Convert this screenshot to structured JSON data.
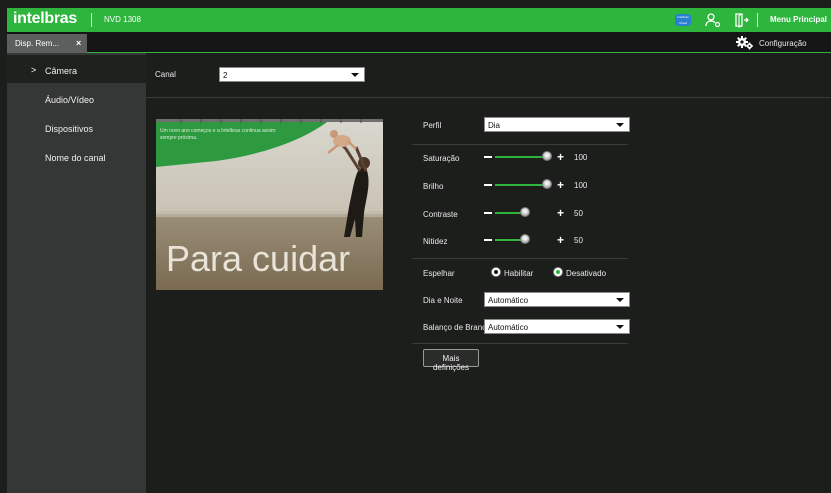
{
  "header": {
    "logo": "intelbras",
    "model": "NVD 1308",
    "cloud_label": "Intelbras Cloud",
    "menu_principal": "Menu Principal",
    "icons": [
      "cloud-icon",
      "user-settings-icon",
      "logout-icon"
    ]
  },
  "tabs": {
    "active_tab": "Disp. Rem...",
    "close": "×",
    "config_label": "Configuração"
  },
  "sidebar": {
    "items": [
      {
        "label": "Câmera",
        "active": true
      },
      {
        "label": "Áudio/Vídeo",
        "active": false
      },
      {
        "label": "Dispositivos",
        "active": false
      },
      {
        "label": "Nome do canal",
        "active": false
      }
    ]
  },
  "main": {
    "canal_label": "Canal",
    "canal_value": "2",
    "photo": {
      "caption": "Um novo ano começou e a Intelbras continua assim: sempre próxima.",
      "headline": "Para cuidar"
    },
    "perfil_label": "Perfil",
    "perfil_value": "Dia",
    "sliders": [
      {
        "label": "Saturação",
        "value": 100,
        "fraction": 1.0
      },
      {
        "label": "Brilho",
        "value": 100,
        "fraction": 1.0
      },
      {
        "label": "Contraste",
        "value": 50,
        "fraction": 0.5
      },
      {
        "label": "Nitidez",
        "value": 50,
        "fraction": 0.5
      }
    ],
    "espelhar_label": "Espelhar",
    "espelhar_options": [
      "Habilitar",
      "Desativado"
    ],
    "espelhar_selected": "Desativado",
    "dia_noite_label": "Dia e Noite",
    "dia_noite_value": "Automático",
    "balanco_label": "Balanço de Branco",
    "balanco_value": "Automático",
    "more_button": "Mais definições"
  },
  "colors": {
    "accent": "#2db53d",
    "topbar": "#2db53d",
    "sidebar": "#353736",
    "background": "#1c1e1c",
    "cloud_badge": "#2a7fd1"
  }
}
